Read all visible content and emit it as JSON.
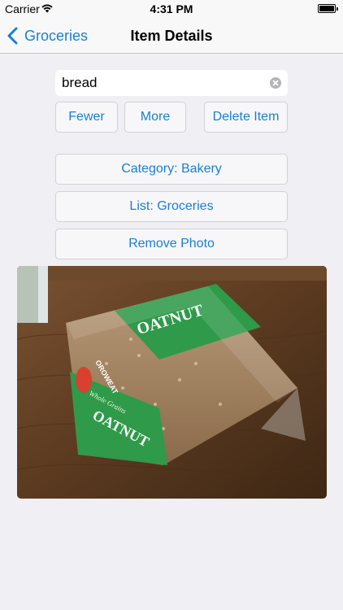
{
  "status_bar": {
    "carrier": "Carrier",
    "time": "4:31 PM"
  },
  "nav": {
    "back_label": "Groceries",
    "title": "Item Details"
  },
  "item": {
    "name_value": "bread"
  },
  "buttons": {
    "fewer": "Fewer",
    "more": "More",
    "delete": "Delete Item",
    "category": "Category: Bakery",
    "list": "List: Groceries",
    "remove_photo": "Remove Photo"
  },
  "photo": {
    "brand": "OROWEAT",
    "product": "OATNUT",
    "tagline": "Whole Grains"
  },
  "colors": {
    "accent": "#1a7fd6",
    "background": "#efeff4"
  }
}
